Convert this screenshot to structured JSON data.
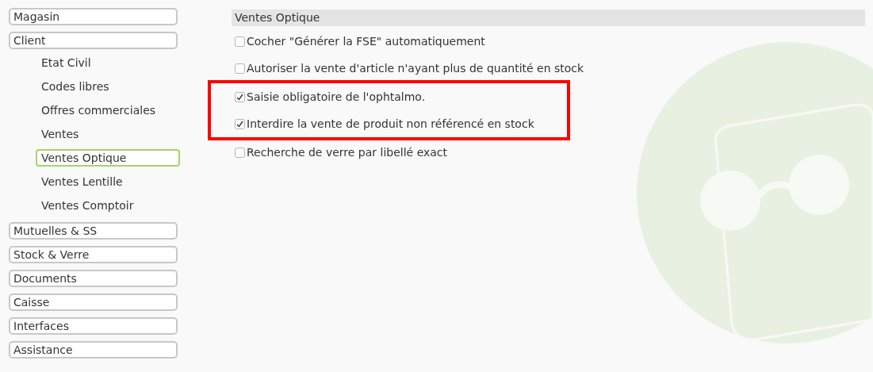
{
  "sidebar": {
    "sections": [
      {
        "label": "Magasin"
      },
      {
        "label": "Client",
        "children": [
          {
            "label": "Etat Civil",
            "selected": false
          },
          {
            "label": "Codes libres",
            "selected": false
          },
          {
            "label": "Offres commerciales",
            "selected": false
          },
          {
            "label": "Ventes",
            "selected": false
          },
          {
            "label": "Ventes Optique",
            "selected": true
          },
          {
            "label": "Ventes Lentille",
            "selected": false
          },
          {
            "label": "Ventes Comptoir",
            "selected": false
          }
        ]
      },
      {
        "label": "Mutuelles & SS"
      },
      {
        "label": "Stock & Verre"
      },
      {
        "label": "Documents"
      },
      {
        "label": "Caisse"
      },
      {
        "label": "Interfaces"
      },
      {
        "label": "Assistance"
      }
    ]
  },
  "panel": {
    "title": "Ventes Optique",
    "options": [
      {
        "label": "Cocher \"Générer la FSE\" automatiquement",
        "checked": false,
        "highlighted": false
      },
      {
        "label": "Autoriser la vente d'article n'ayant plus de quantité en stock",
        "checked": false,
        "highlighted": false
      },
      {
        "label": "Saisie obligatoire de l'ophtalmo.",
        "checked": true,
        "highlighted": true
      },
      {
        "label": "Interdire la vente de produit non référencé en stock",
        "checked": true,
        "highlighted": true
      },
      {
        "label": "Recherche de verre par libellé exact",
        "checked": false,
        "highlighted": false
      }
    ]
  }
}
